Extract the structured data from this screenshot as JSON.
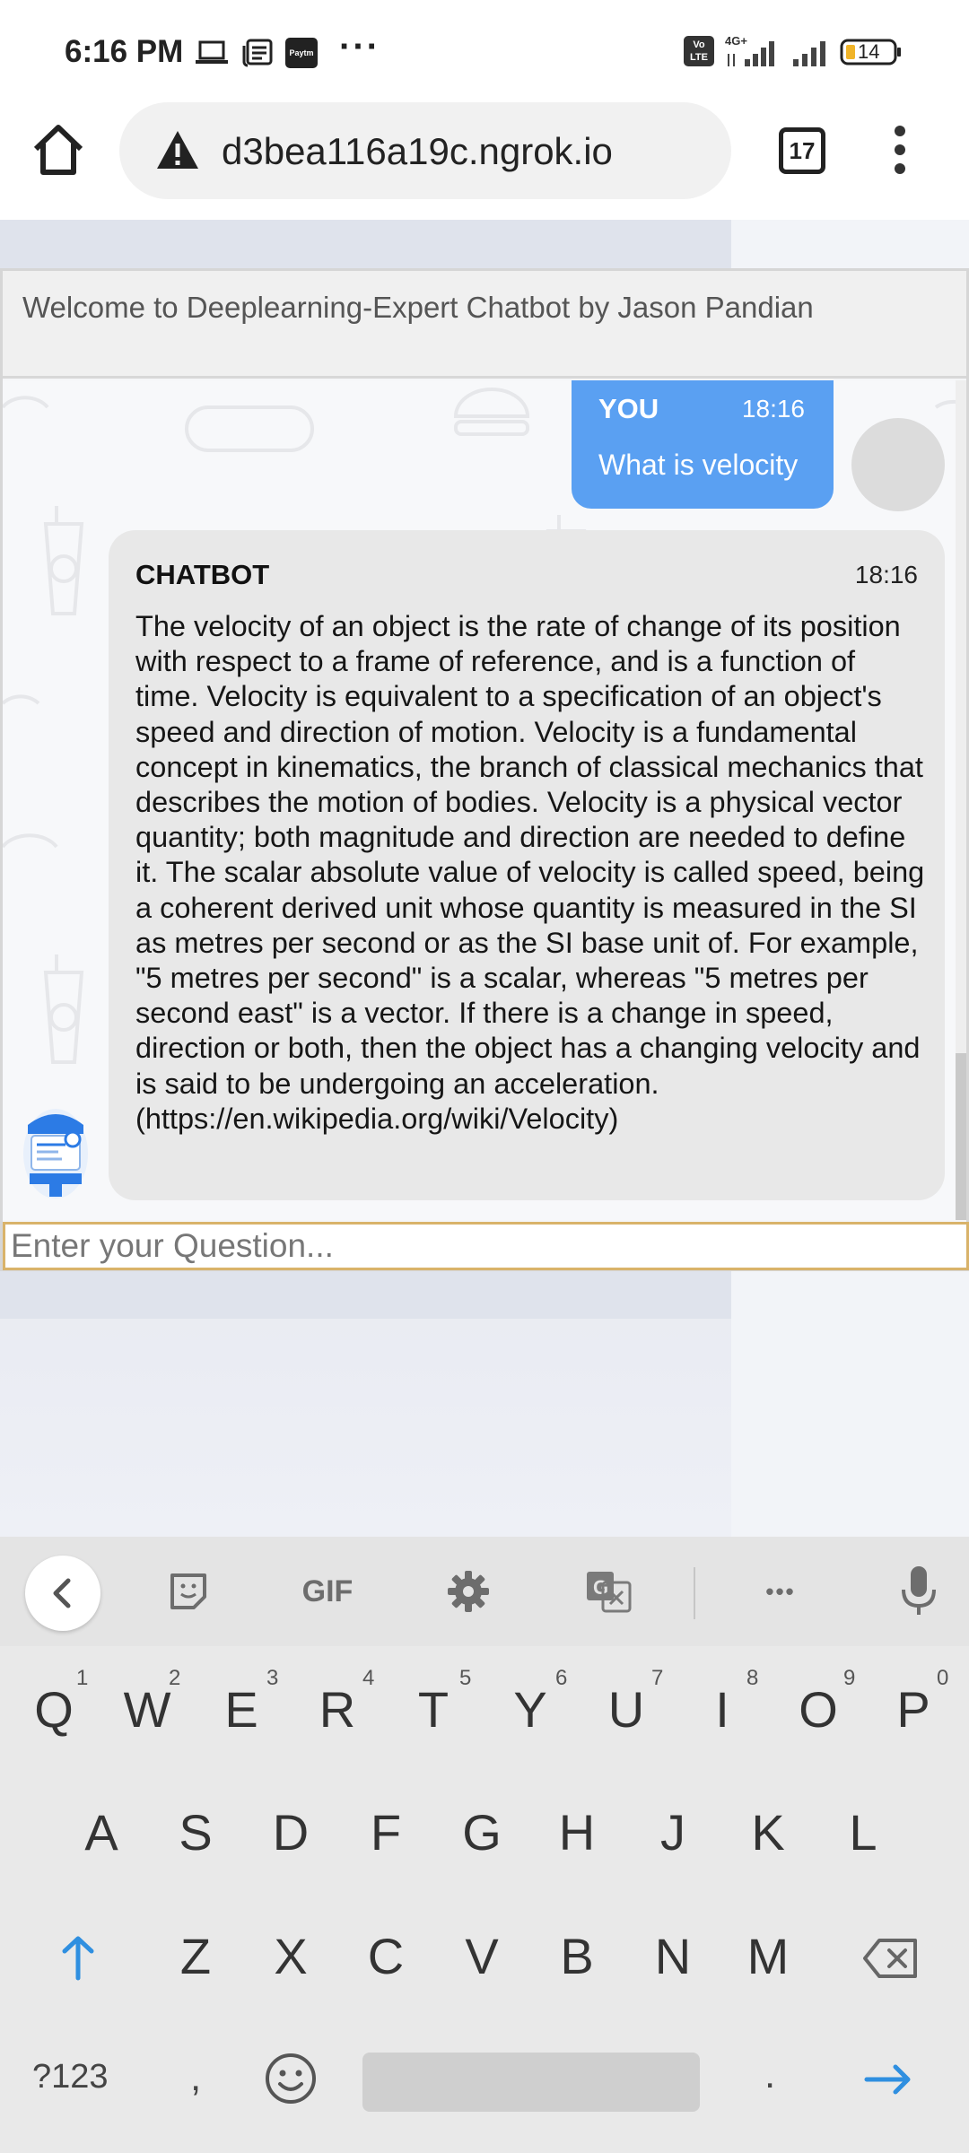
{
  "status_bar": {
    "time": "6:16 PM",
    "icons": [
      "laptop-icon",
      "news-icon",
      "paytm-icon"
    ],
    "paytm_label": "Paytm",
    "more": "···",
    "network_label": "4G+",
    "volte_label": "Vo LTE",
    "battery": "14"
  },
  "browser": {
    "url": "d3bea116a19c.ngrok.io",
    "tab_count": "17"
  },
  "chat": {
    "header_title": "Welcome to Deeplearning-Expert Chatbot by Jason Pandian",
    "user_message": {
      "sender": "YOU",
      "time": "18:16",
      "text": "What is velocity"
    },
    "bot_message": {
      "sender": "CHATBOT",
      "time": "18:16",
      "text": "The velocity of an object is the rate of change of its position with respect to a frame of reference, and is a function of time. Velocity is equivalent to a specification of an object's speed and direction of motion. Velocity is a fundamental concept in kinematics, the branch of classical mechanics that describes the motion of bodies. Velocity is a physical vector quantity; both magnitude and direction are needed to define it. The scalar absolute value of velocity is called speed, being a coherent derived unit whose quantity is measured in the SI as metres per second or as the SI base unit of. For example, \"5 metres per second\" is a scalar, whereas \"5 metres per second east\" is a vector. If there is a change in speed, direction or both, then the object has a changing velocity and is said to be undergoing an acceleration. (https://en.wikipedia.org/wiki/Velocity)"
    },
    "input_placeholder": "Enter your Question..."
  },
  "keyboard": {
    "toolbar": {
      "gif_label": "GIF",
      "more_label": "•••"
    },
    "row1": [
      {
        "key": "Q",
        "hint": "1"
      },
      {
        "key": "W",
        "hint": "2"
      },
      {
        "key": "E",
        "hint": "3"
      },
      {
        "key": "R",
        "hint": "4"
      },
      {
        "key": "T",
        "hint": "5"
      },
      {
        "key": "Y",
        "hint": "6"
      },
      {
        "key": "U",
        "hint": "7"
      },
      {
        "key": "I",
        "hint": "8"
      },
      {
        "key": "O",
        "hint": "9"
      },
      {
        "key": "P",
        "hint": "0"
      }
    ],
    "row2": [
      "A",
      "S",
      "D",
      "F",
      "G",
      "H",
      "J",
      "K",
      "L"
    ],
    "row3": [
      "Z",
      "X",
      "C",
      "V",
      "B",
      "N",
      "M"
    ],
    "bottom": {
      "symbols": "?123",
      "comma": ",",
      "period": "."
    },
    "accent_color": "#2f8fe0"
  }
}
